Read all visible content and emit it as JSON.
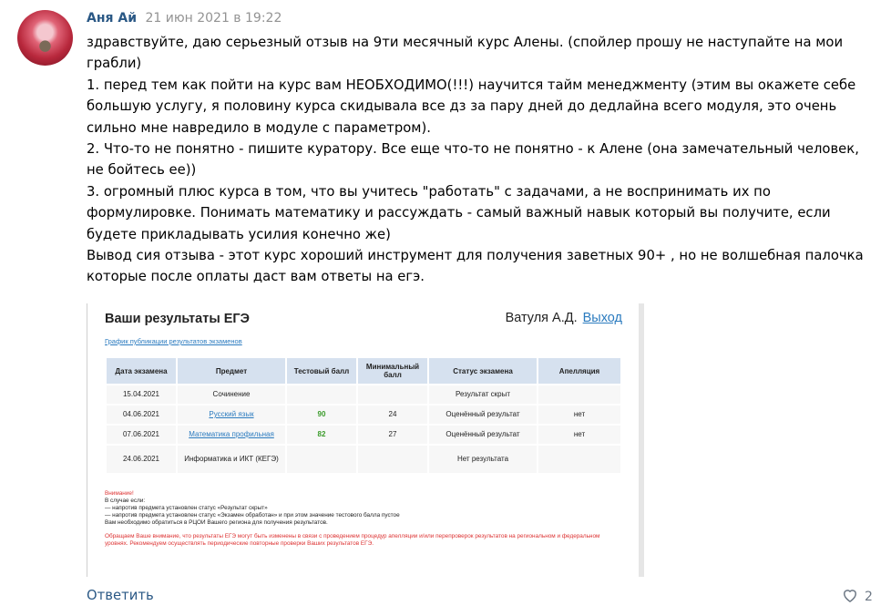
{
  "post": {
    "author": "Аня Ай",
    "date": "21 июн 2021 в 19:22",
    "paragraphs": [
      "здравствуйте, даю серьезный отзыв на 9ти месячный курс Алены. (спойлер прошу не наступайте на мои грабли)",
      "1. перед тем как пойти на курс вам НЕОБХОДИМО(!!!) научится тайм менеджменту (этим вы окажете себе большую услугу, я половину курса скидывала все дз за пару дней до дедлайна всего модуля, это очень сильно мне навредило в модуле с параметром).",
      "2. Что-то не понятно - пишите куратору. Все еще что-то не понятно - к Алене (она замечательный человек, не бойтесь ее))",
      "3. огромный плюс курса в том, что вы учитесь \"работать\" с задачами, а не воспринимать их по формулировке. Понимать математику и рассуждать - самый важный навык который вы получите, если будете прикладывать усилия конечно же)",
      "Вывод сия отзыва - этот курс хороший инструмент для получения заветных 90+ , но не волшебная палочка которые после оплаты даст вам ответы на егэ."
    ]
  },
  "attachment": {
    "title": "Ваши результаты ЕГЭ",
    "user_name": "Ватуля А.Д.",
    "logout_label": "Выход",
    "schedule_link": "График публикации результатов экзаменов",
    "columns": [
      "Дата экзамена",
      "Предмет",
      "Тестовый балл",
      "Минимальный балл",
      "Статус экзамена",
      "Апелляция"
    ],
    "rows": [
      {
        "date": "15.04.2021",
        "subject": "Сочинение",
        "score": "",
        "min": "",
        "status": "Результат скрыт",
        "appeal": ""
      },
      {
        "date": "04.06.2021",
        "subject": "Русский язык",
        "score": "90",
        "min": "24",
        "status": "Оценённый результат",
        "appeal": "нет"
      },
      {
        "date": "07.06.2021",
        "subject": "Математика профильная",
        "score": "82",
        "min": "27",
        "status": "Оценённый результат",
        "appeal": "нет"
      },
      {
        "date": "24.06.2021",
        "subject": "Информатика и ИКТ (КЕГЭ)",
        "score": "",
        "min": "",
        "status": "Нет результата",
        "appeal": ""
      }
    ],
    "notes": {
      "attention": "Внимание!",
      "lines": [
        "В случае если:",
        "— напротив предмета установлен статус «Результат скрыт»",
        "— напротив предмета установлен статус «Экзамен обработан» и при этом значение тестового балла пустое",
        "Вам необходимо обратиться в РЦОИ Вашего региона для получения результатов."
      ],
      "warning": "Обращаем Ваше внимание, что результаты ЕГЭ могут быть изменены в связи с проведением процедур апелляции и/или перепроверок результатов на региональном и федеральном уровнях. Рекомендуем осуществлять периодические повторные проверки Ваших результатов ЕГЭ."
    }
  },
  "footer": {
    "reply_label": "Ответить",
    "likes_count": "2"
  }
}
